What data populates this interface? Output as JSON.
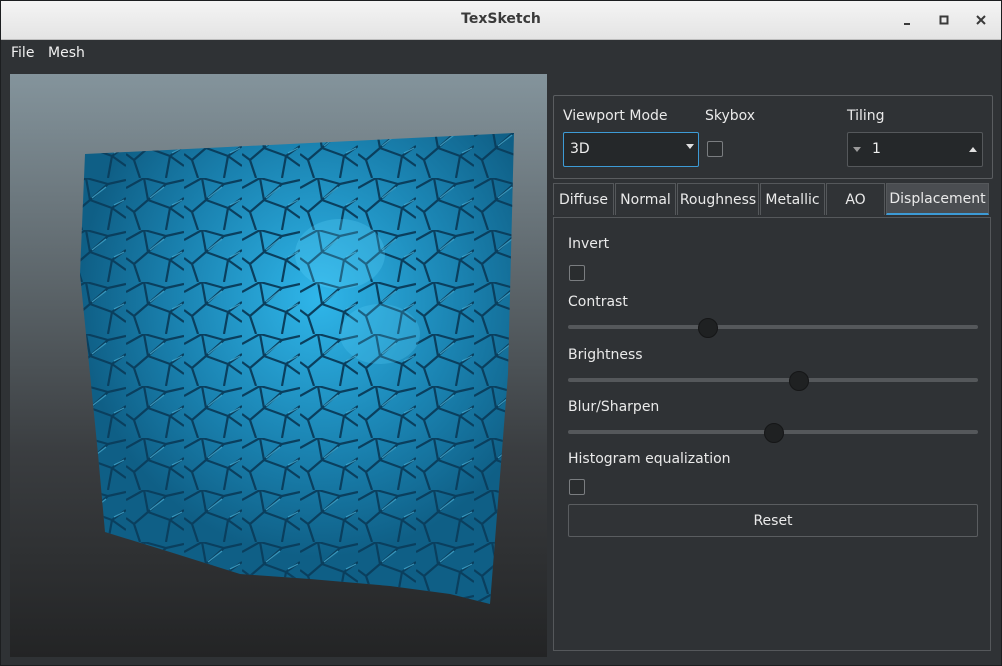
{
  "window": {
    "title": "TexSketch"
  },
  "menu": {
    "file": "File",
    "mesh": "Mesh"
  },
  "controls": {
    "viewport_mode_label": "Viewport Mode",
    "viewport_mode_value": "3D",
    "skybox_label": "Skybox",
    "skybox_checked": false,
    "tiling_label": "Tiling",
    "tiling_value": "1"
  },
  "tabs": [
    {
      "label": "Diffuse"
    },
    {
      "label": "Normal"
    },
    {
      "label": "Roughness"
    },
    {
      "label": "Metallic"
    },
    {
      "label": "AO"
    },
    {
      "label": "Displacement",
      "active": true
    }
  ],
  "displacement": {
    "invert_label": "Invert",
    "invert_checked": false,
    "contrast_label": "Contrast",
    "contrast_value": 0.34,
    "brightness_label": "Brightness",
    "brightness_value": 0.56,
    "blur_label": "Blur/Sharpen",
    "blur_value": 0.5,
    "hist_label": "Histogram equalization",
    "hist_checked": false,
    "reset_label": "Reset"
  },
  "colors": {
    "accent": "#3d9bd6",
    "mesh": "#1d86b3"
  }
}
